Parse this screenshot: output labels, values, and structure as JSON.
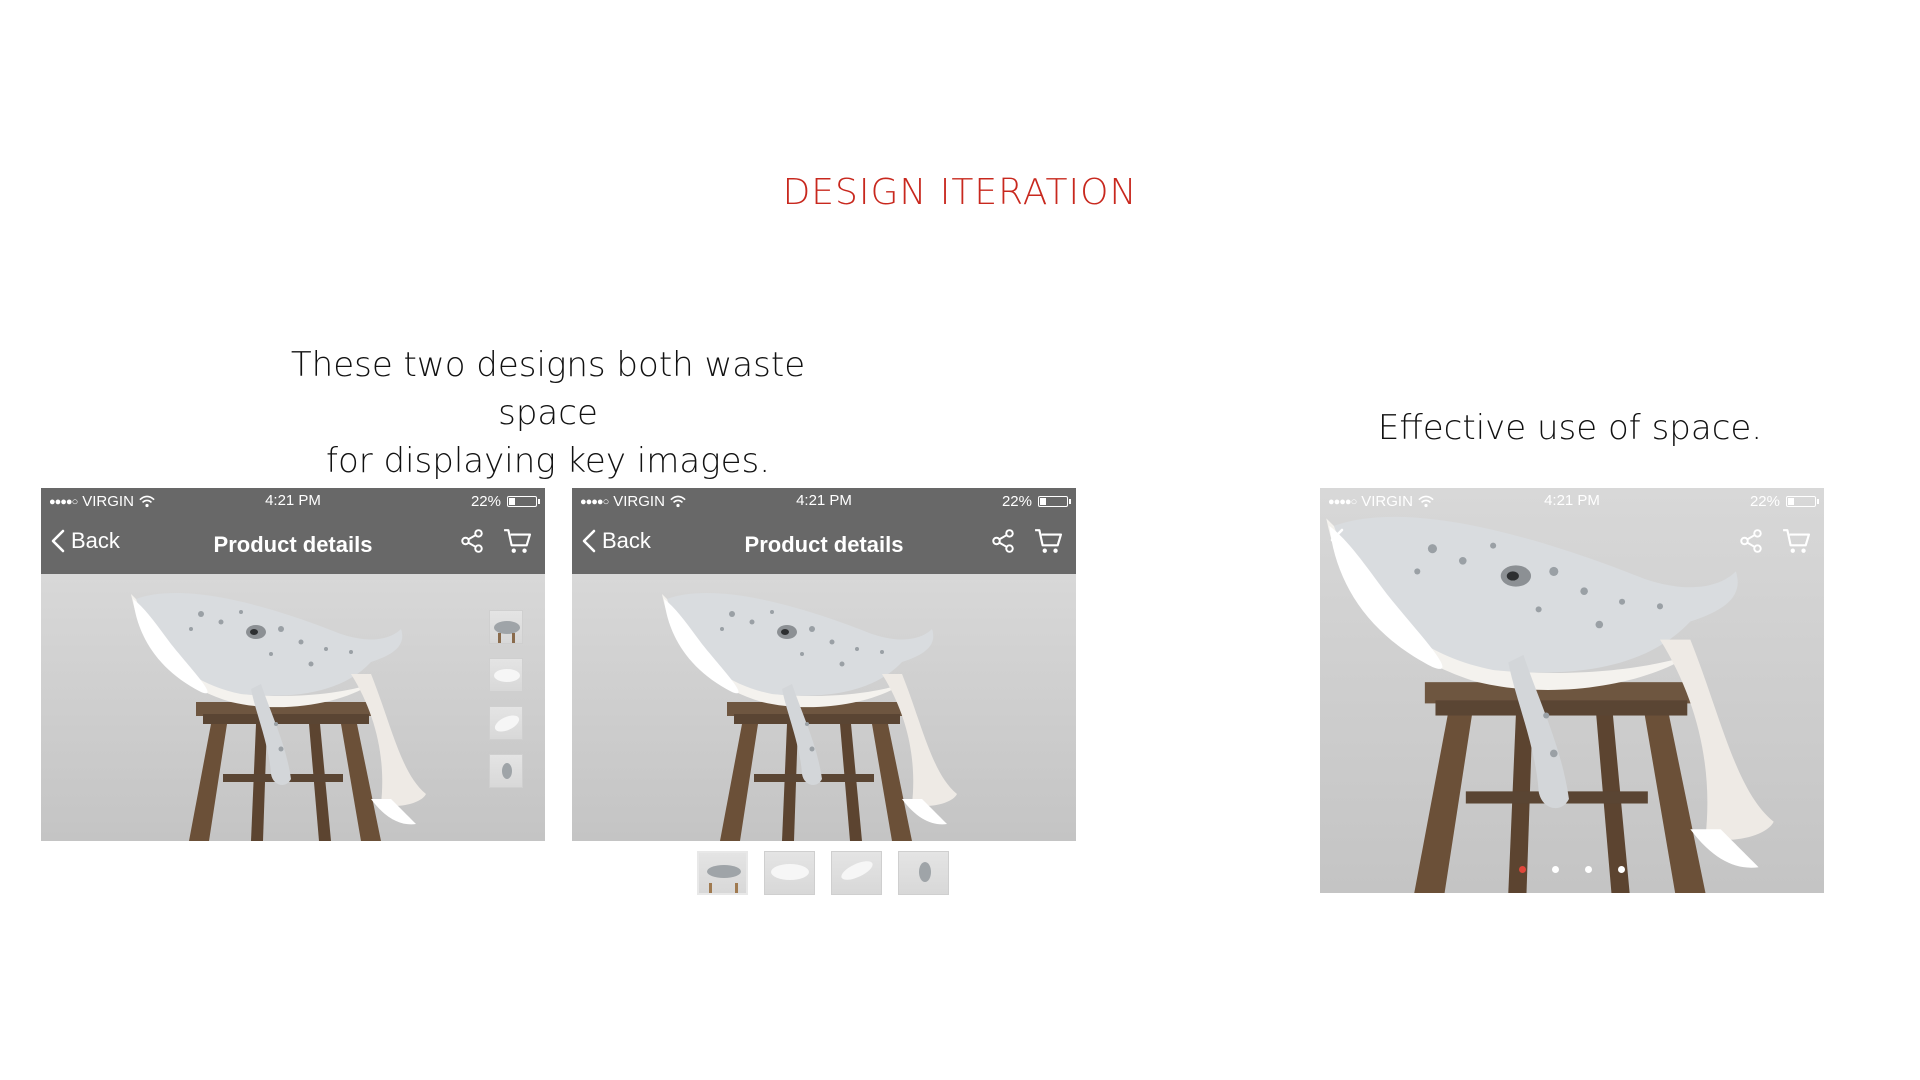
{
  "header": {
    "title": "DESIGN ITERATION"
  },
  "captions": {
    "left_line1": "These two designs both waste space",
    "left_line2": "for displaying key images.",
    "right": "Effective use of space."
  },
  "status_bar": {
    "carrier": "VIRGIN",
    "time": "4:21 PM",
    "battery": "22%",
    "battery_level": 0.22
  },
  "nav": {
    "back_label": "Back",
    "title": "Product details",
    "icons": [
      "chevron-left-icon",
      "share-icon",
      "cart-icon"
    ]
  },
  "mockups": [
    {
      "name": "thumbnails-on-image",
      "thumbnails": 4
    },
    {
      "name": "thumbnails-below-image",
      "thumbnails": 4
    },
    {
      "name": "fullscreen-pager",
      "pages": 4,
      "active_page": 1
    }
  ],
  "colors": {
    "accent": "#c8281e",
    "navbar": "#686868",
    "pager_active": "#e0463a"
  }
}
